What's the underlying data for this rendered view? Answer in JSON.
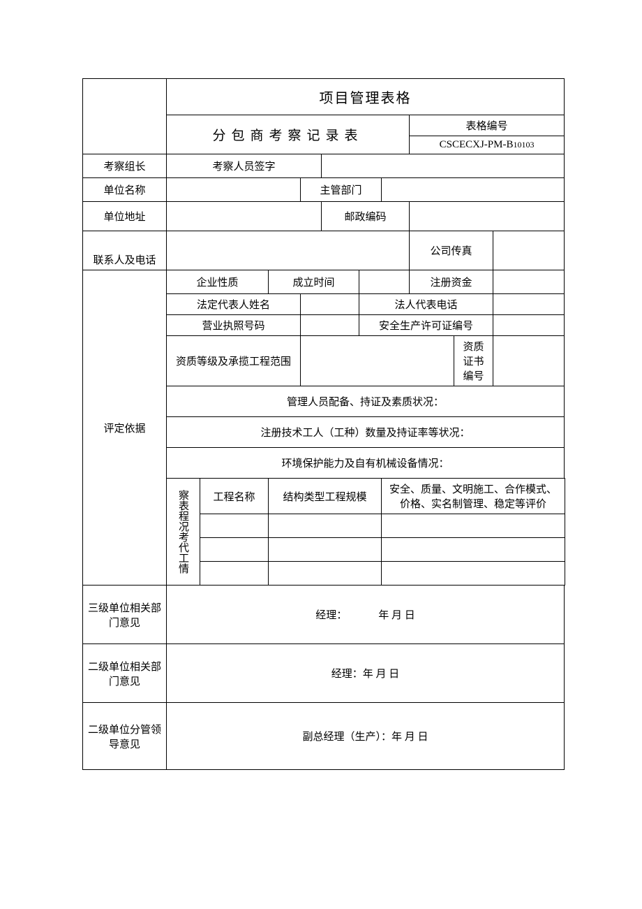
{
  "header": {
    "main_title": "项目管理表格",
    "sub_title": "分包商考察记录表",
    "form_no_label": "表格编号",
    "form_no_value_prefix": "CSCECXJ-P",
    "form_no_value_mid": "M",
    "form_no_value_suffix": "-B",
    "form_no_value_num": "10103"
  },
  "labels": {
    "inspect_leader": "考察组长",
    "inspect_sign": "考察人员签字",
    "unit_name": "单位名称",
    "dept": "主管部门",
    "unit_addr": "单位地址",
    "postcode": "邮政编码",
    "contact": "联系人及电话",
    "fax": "公司传真",
    "basis": "评定依据",
    "ent_nature": "企业性质",
    "est_time": "成立时间",
    "reg_capital": "注册资金",
    "legal_name": "法定代表人姓名",
    "legal_phone": "法人代表电话",
    "license_no": "营业执照号码",
    "safety_no": "安全生产许可证编号",
    "qual_scope": "资质等级及承揽工程范围",
    "qual_cert_no": "资质证书编号",
    "mgmt_status": "管理人员配备、持证及素质状况：",
    "workers_status": "注册技术工人（工种）数量及持证率等状况：",
    "env_status": "环境保护能力及自有机械设备情况：",
    "proj_record_v": "察表程况考代工情",
    "proj_name": "工程名称",
    "proj_type_scale": "结构类型工程规模",
    "proj_eval": "安全、质量、文明施工、合作模式、价格、实名制管理、稳定等评价",
    "l3_opinion": "三级单位相关部门意见",
    "l2_opinion": "二级单位相关部门意见",
    "l2_leader_opinion": "二级单位分管领导意见",
    "l3_sig": "经理：   年 月 日",
    "l2_sig": "经理：年 月 日",
    "leader_sig": "副总经理（生产）：年 月 日"
  },
  "values": {
    "inspect_leader": "",
    "inspect_sign": "",
    "sign_blank": "",
    "unit_name": "",
    "dept": "",
    "unit_addr": "",
    "postcode": "",
    "contact": "",
    "fax": "",
    "ent_nature": "",
    "est_time": "",
    "est_blank": "",
    "reg_capital": "",
    "legal_name": "",
    "legal_phone": "",
    "legal_phone_blank": "",
    "license_no": "",
    "safety_no": "",
    "safety_blank": "",
    "qual_scope": "",
    "qual_cert_no": "",
    "mgmt_status": "",
    "workers_status": "",
    "env_status": "",
    "proj_rows": [
      {
        "name": "",
        "scale": "",
        "eval": ""
      },
      {
        "name": "",
        "scale": "",
        "eval": ""
      },
      {
        "name": "",
        "scale": "",
        "eval": ""
      }
    ],
    "l3_opinion": "",
    "l2_opinion": "",
    "l2_leader_opinion": ""
  }
}
